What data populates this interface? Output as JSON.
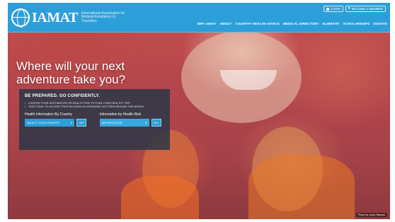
{
  "brand": {
    "logo_word": "IAMAT",
    "tagline": "International Association for Medical Assistance to Travellers"
  },
  "util": {
    "login": "LOGIN",
    "become_member": "BECOME A MEMBER"
  },
  "nav": {
    "items": [
      "WHY IAMAT",
      "ABOUT",
      "COUNTRY HEALTH ADVICE",
      "MEDICAL DIRECTORY",
      "eLIBRARY",
      "SCHOLARSHIPS",
      "DONATE"
    ]
  },
  "hero": {
    "headline": "Where will your next adventure take you?"
  },
  "card": {
    "title": "BE PREPARED. GO CONFIDENTLY.",
    "bullets": [
      "CHOOSE YOUR DESTINATION OR HEALTH RISK TO PLAN YOUR HEALTHY TRIP",
      "JOIN TODAY TO ACCESS TRUSTED ENGLISH-SPEAKING DOCTORS AROUND THE WORLD"
    ],
    "country": {
      "label": "Health Information By Country",
      "select_value": "SELECT YOUR COUNTRY",
      "go": "GO"
    },
    "risk": {
      "label": "Information by Health Risk",
      "select_value": "AIR POLLUTION",
      "go": "GO"
    }
  },
  "photo_credit": "Photo by: Andy Sikaraw",
  "colors": {
    "brand_blue": "#2d9fd8",
    "card_bg": "#28374680"
  }
}
